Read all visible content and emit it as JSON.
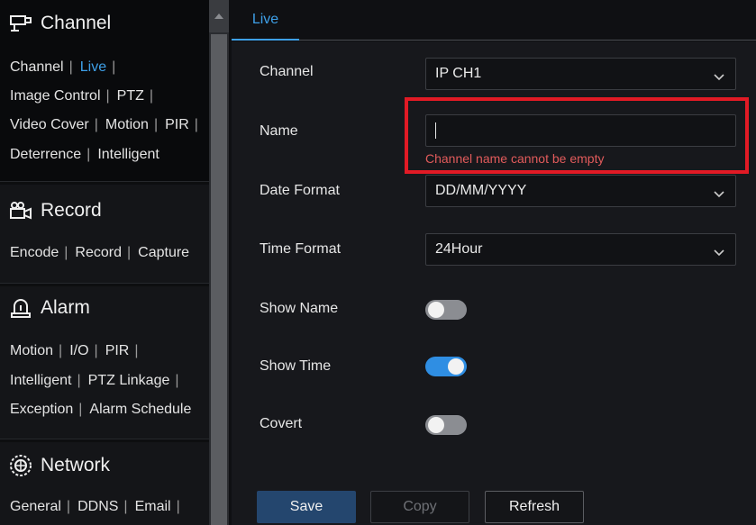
{
  "sidebar": {
    "channel": {
      "title": "Channel",
      "icon": "camera-icon",
      "rows": [
        [
          {
            "label": "Channel",
            "active": false
          },
          {
            "label": "Live",
            "active": true
          }
        ],
        [
          {
            "label": "Image Control"
          },
          {
            "label": "PTZ"
          }
        ],
        [
          {
            "label": "Video Cover"
          },
          {
            "label": "Motion"
          },
          {
            "label": "PIR"
          }
        ],
        [
          {
            "label": "Deterrence"
          },
          {
            "label": "Intelligent"
          }
        ]
      ]
    },
    "record": {
      "title": "Record",
      "icon": "video-camera-icon",
      "rows": [
        [
          {
            "label": "Encode"
          },
          {
            "label": "Record"
          },
          {
            "label": "Capture"
          }
        ]
      ]
    },
    "alarm": {
      "title": "Alarm",
      "icon": "alarm-light-icon",
      "rows": [
        [
          {
            "label": "Motion"
          },
          {
            "label": "I/O"
          },
          {
            "label": "PIR"
          }
        ],
        [
          {
            "label": "Intelligent"
          },
          {
            "label": "PTZ Linkage"
          }
        ],
        [
          {
            "label": "Exception"
          },
          {
            "label": "Alarm Schedule"
          }
        ]
      ]
    },
    "network": {
      "title": "Network",
      "icon": "globe-icon",
      "rows": [
        [
          {
            "label": "General"
          },
          {
            "label": "DDNS"
          },
          {
            "label": "Email"
          }
        ]
      ]
    },
    "separator": "|"
  },
  "tabs": [
    {
      "label": "Live",
      "active": true
    }
  ],
  "form": {
    "channel": {
      "label": "Channel",
      "value": "IP CH1"
    },
    "name": {
      "label": "Name",
      "value": "",
      "error": "Channel name cannot be empty"
    },
    "date_format": {
      "label": "Date Format",
      "value": "DD/MM/YYYY"
    },
    "time_format": {
      "label": "Time Format",
      "value": "24Hour"
    },
    "show_name": {
      "label": "Show Name",
      "on": false
    },
    "show_time": {
      "label": "Show Time",
      "on": true
    },
    "covert": {
      "label": "Covert",
      "on": false
    }
  },
  "buttons": {
    "save": "Save",
    "copy": "Copy",
    "refresh": "Refresh"
  },
  "colors": {
    "accent": "#3ea0e8",
    "error": "#e25b5b",
    "highlight_box": "#e21a25",
    "toggle_on": "#2f8ee3"
  }
}
